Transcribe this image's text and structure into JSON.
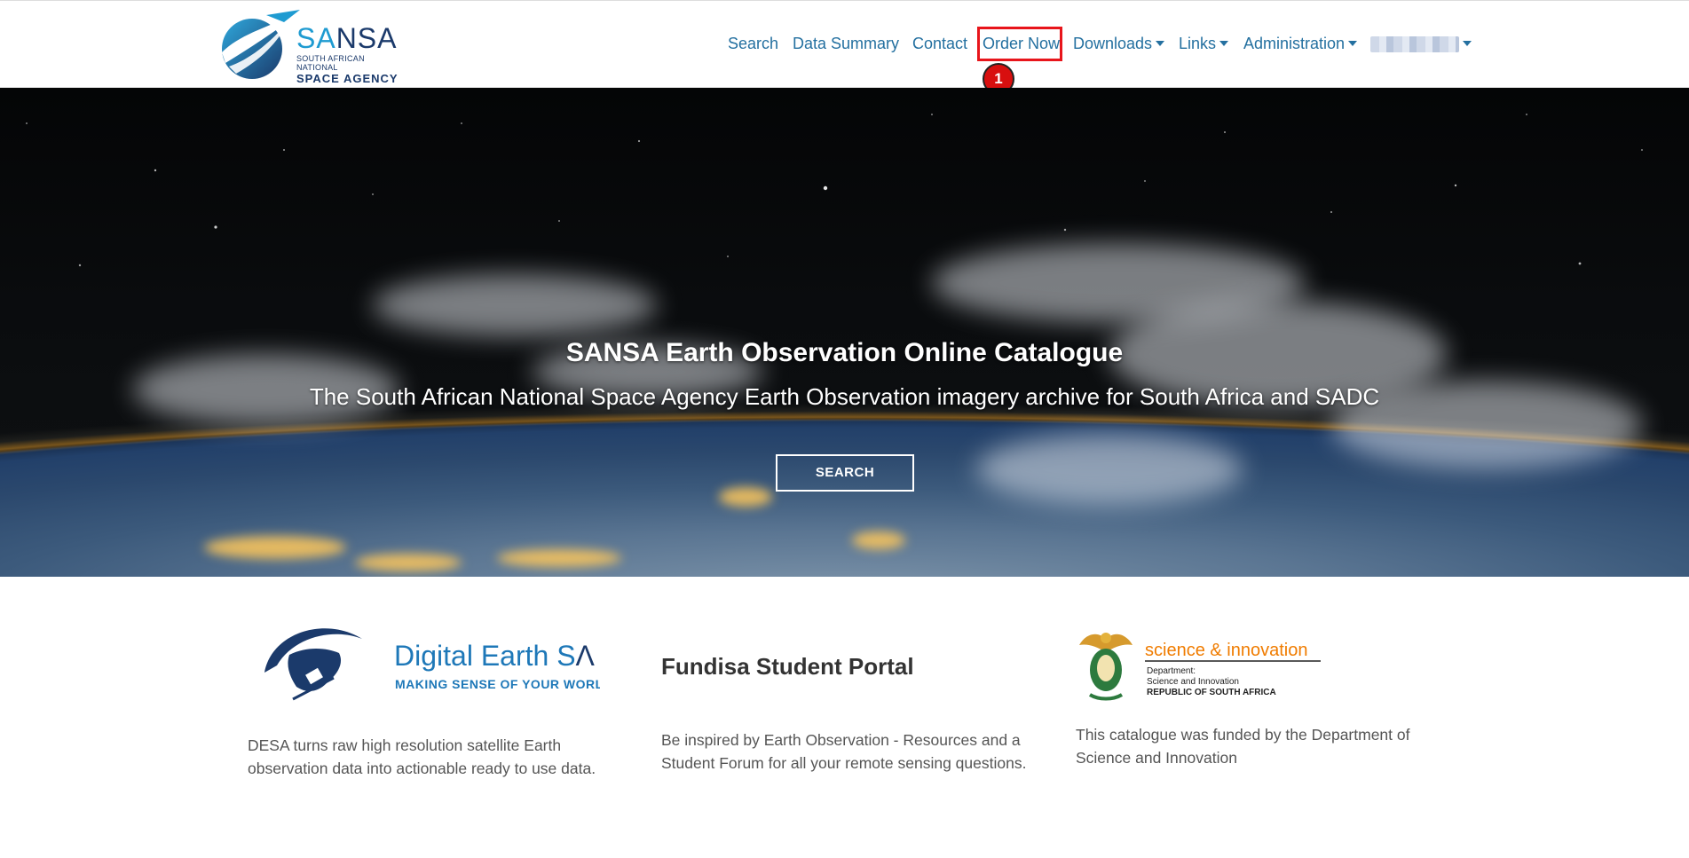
{
  "brand": {
    "name_part1": "SA",
    "name_part2": "NSA",
    "sub1": "SOUTH AFRICAN NATIONAL",
    "sub2": "SPACE AGENCY"
  },
  "nav": {
    "search": "Search",
    "data_summary": "Data Summary",
    "contact": "Contact",
    "order_now": "Order Now",
    "downloads": "Downloads",
    "links": "Links",
    "administration": "Administration",
    "step_badge": "1"
  },
  "hero": {
    "title": "SANSA Earth Observation Online Catalogue",
    "subtitle": "The South African National Space Agency Earth Observation imagery archive for South Africa and SADC",
    "button": "SEARCH"
  },
  "columns": {
    "desa": {
      "logo_name_1": "Digital Earth S",
      "logo_name_2": "Λ",
      "logo_tagline": "MAKING SENSE OF YOUR WORLD",
      "text": "DESA turns raw high resolution satellite Earth observation data into actionable ready to use data."
    },
    "fundisa": {
      "title": "Fundisa Student Portal",
      "text": "Be inspired by Earth Observation - Resources and a Student Forum for all your remote sensing questions."
    },
    "dsi": {
      "logo_title": "science & innovation",
      "logo_line1": "Department:",
      "logo_line2": "Science and Innovation",
      "logo_line3": "REPUBLIC OF SOUTH AFRICA",
      "text": "This catalogue was funded by the Department of Science and Innovation"
    }
  },
  "colors": {
    "nav_link": "#2470a0",
    "brand_dark": "#1b3a6b",
    "brand_light": "#1f9bd1",
    "highlight": "#e8151b",
    "dsi_orange": "#f07c00"
  }
}
